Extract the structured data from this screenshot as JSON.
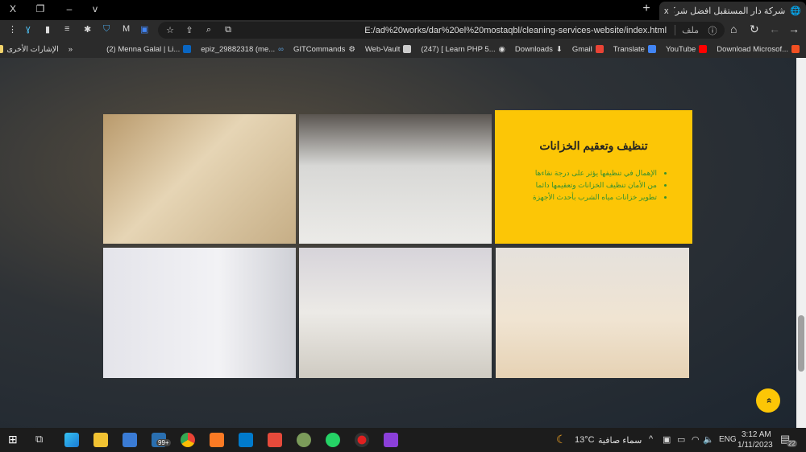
{
  "window": {
    "close": "X",
    "restore": "❐",
    "minimize": "–",
    "menu": "v"
  },
  "tab": {
    "title": "شركة دار المستقبل افضل شركة تنظ",
    "close": "x",
    "new_tab": "+"
  },
  "toolbar": {
    "url": "E:/ad%20works/dar%20el%20mostaqbl/cleaning-services-website/index.html",
    "file_label": "ملف",
    "info": "ⓘ"
  },
  "bookmarks": [
    {
      "label": "Download Microsof...",
      "color": "#f25022"
    },
    {
      "label": "YouTube",
      "color": "#ff0000"
    },
    {
      "label": "Translate",
      "color": "#4285f4"
    },
    {
      "label": "Gmail",
      "color": "#ea4335"
    },
    {
      "label": "Downloads",
      "color": "#dddddd"
    },
    {
      "label": "(247) [ Learn PHP 5...",
      "color": "#ffffff"
    },
    {
      "label": "Web-Vault",
      "color": "#cccccc"
    },
    {
      "label": "GITCommands",
      "color": "#888888"
    },
    {
      "label": "epiz_29882318 (me...",
      "color": "#5b9bd5"
    },
    {
      "label": "(2) Menna Galal | Li...",
      "color": "#0a66c2"
    }
  ],
  "other_bookmarks": "الإشارات الأخرى",
  "more": "»",
  "card": {
    "title": "تنظيف وتعقيم الخزانات",
    "items": [
      "الإهمال في تنظيفها يؤثر على درجة نقاءها",
      "من الأمان تنظيف الخزانات وتعقيمها دائما",
      "تطوير خزانات مياه الشرب بأحدث الأجهزة"
    ],
    "color": "#fcc606"
  },
  "back_to_top": "»",
  "taskbar": {
    "weather": "سماء صافية",
    "temp": "13°C",
    "lang": "ENG",
    "time": "3:12 AM",
    "date": "1/11/2023",
    "notifications": "22",
    "store_badge": "99+"
  }
}
